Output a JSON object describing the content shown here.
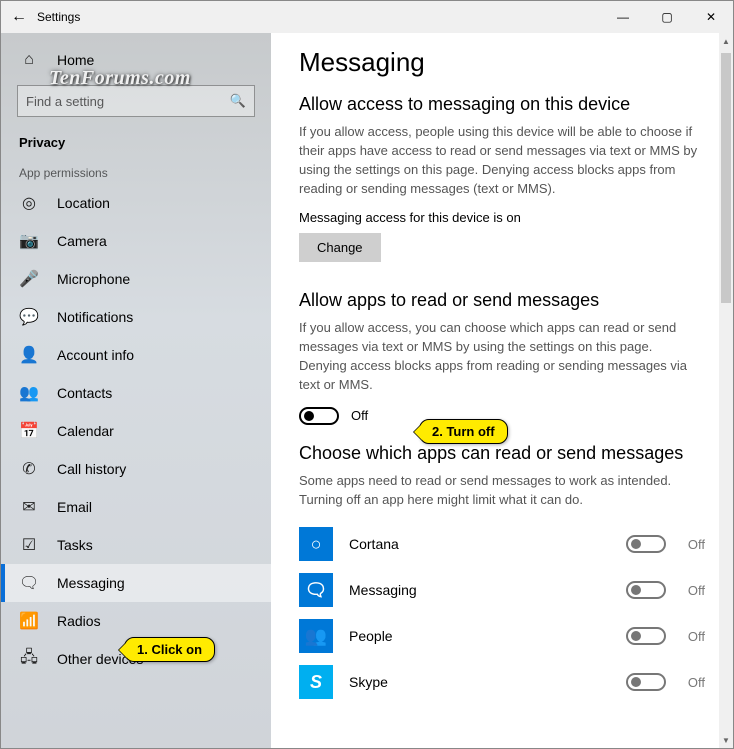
{
  "titlebar": {
    "title": "Settings"
  },
  "watermark": "TenForums.com",
  "sidebar": {
    "home": "Home",
    "search_placeholder": "Find a setting",
    "current_section": "Privacy",
    "group_label": "App permissions",
    "items": [
      {
        "icon": "◎",
        "label": "Location"
      },
      {
        "icon": "📷",
        "label": "Camera"
      },
      {
        "icon": "🎤",
        "label": "Microphone"
      },
      {
        "icon": "💬",
        "label": "Notifications"
      },
      {
        "icon": "👤",
        "label": "Account info"
      },
      {
        "icon": "👥",
        "label": "Contacts"
      },
      {
        "icon": "📅",
        "label": "Calendar"
      },
      {
        "icon": "✆",
        "label": "Call history"
      },
      {
        "icon": "✉",
        "label": "Email"
      },
      {
        "icon": "☑",
        "label": "Tasks"
      },
      {
        "icon": "🗨",
        "label": "Messaging",
        "active": true
      },
      {
        "icon": "📶",
        "label": "Radios"
      },
      {
        "icon": "🖧",
        "label": "Other devices"
      }
    ]
  },
  "page": {
    "title": "Messaging",
    "sec1_heading": "Allow access to messaging on this device",
    "sec1_desc": "If you allow access, people using this device will be able to choose if their apps have access to read or send messages via text or MMS by using the settings on this page. Denying access blocks apps from reading or sending messages (text or MMS).",
    "sec1_state": "Messaging access for this device is on",
    "change_btn": "Change",
    "sec2_heading": "Allow apps to read or send messages",
    "sec2_desc": "If you allow access, you can choose which apps can read or send messages via text or MMS by using the settings on this page. Denying access blocks apps from reading or sending messages via text or MMS.",
    "toggle_state": "Off",
    "sec3_heading": "Choose which apps can read or send messages",
    "sec3_desc": "Some apps need to read or send messages to work as intended. Turning off an app here might limit what it can do.",
    "apps": [
      {
        "name": "Cortana",
        "color": "#0078d7",
        "glyph": "○",
        "state": "Off"
      },
      {
        "name": "Messaging",
        "color": "#0078d7",
        "glyph": "🗨",
        "state": "Off"
      },
      {
        "name": "People",
        "color": "#0078d7",
        "glyph": "👥",
        "state": "Off"
      },
      {
        "name": "Skype",
        "color": "#00aff0",
        "glyph": "S",
        "state": "Off"
      }
    ]
  },
  "callouts": {
    "one": "1. Click on",
    "two": "2. Turn off"
  }
}
